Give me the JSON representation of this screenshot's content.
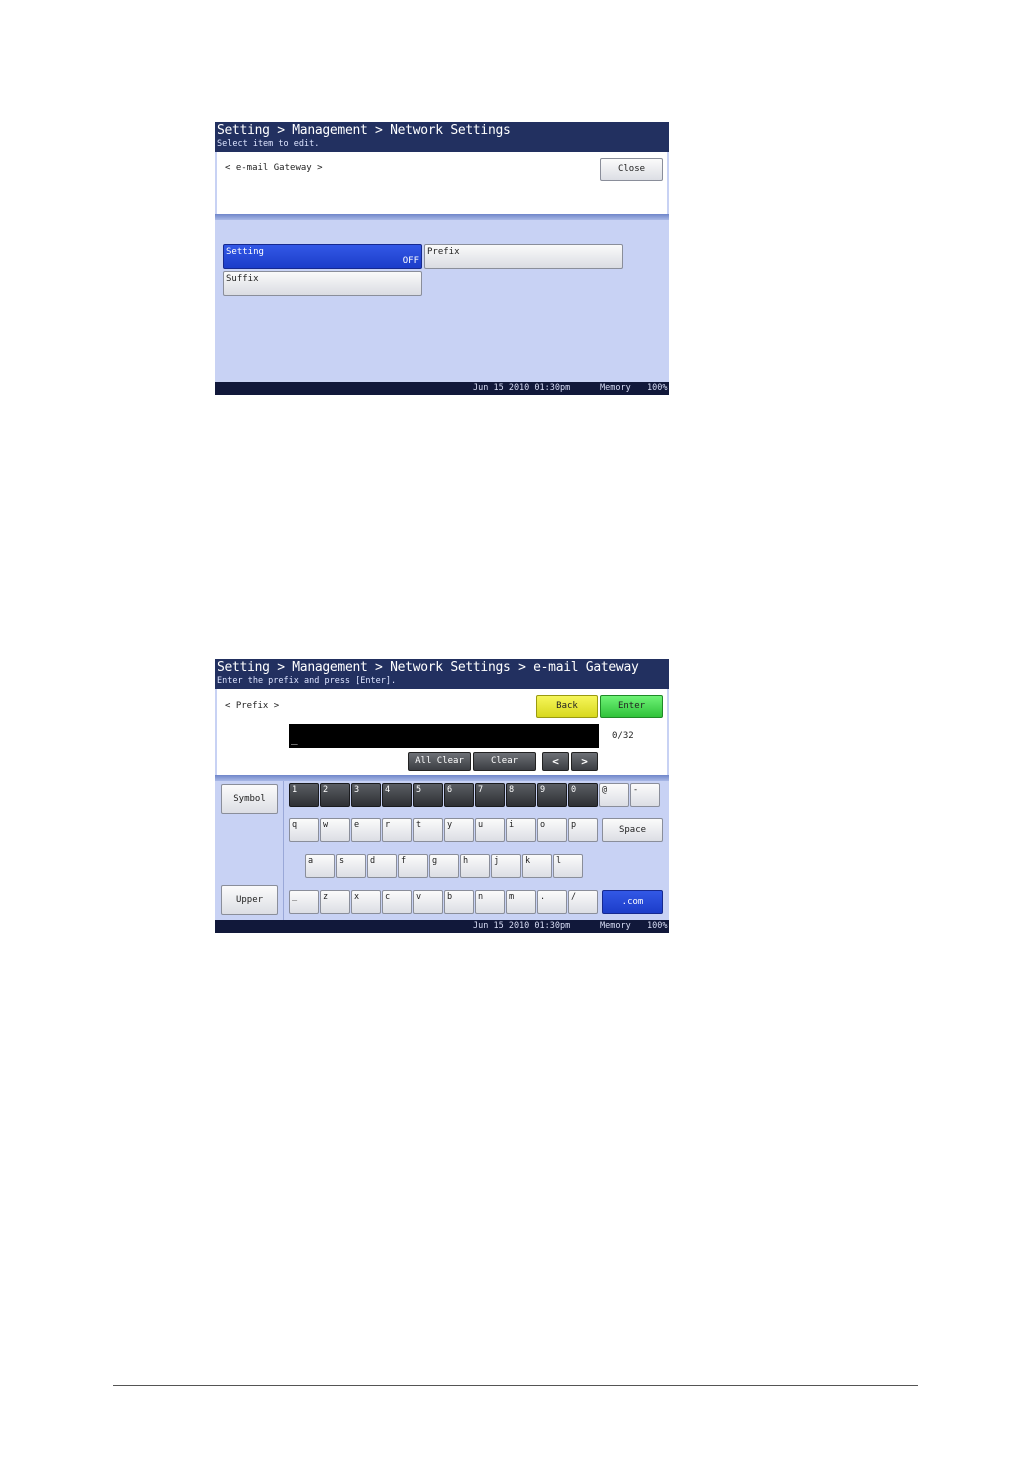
{
  "screen1": {
    "breadcrumb": "Setting > Management > Network Settings",
    "instruction": "Select item to edit.",
    "section_label": "< e-mail Gateway >",
    "close_label": "Close",
    "options": [
      {
        "label": "Setting",
        "value": "OFF",
        "selected": true
      },
      {
        "label": "Prefix",
        "value": "",
        "selected": false
      },
      {
        "label": "Suffix",
        "value": "",
        "selected": false
      }
    ],
    "status": {
      "date": "Jun 15 2010 01:30pm",
      "memory_label": "Memory",
      "memory_value": "100%"
    }
  },
  "screen2": {
    "breadcrumb": "Setting > Management > Network Settings > e-mail Gateway",
    "instruction": "Enter the prefix and press [Enter].",
    "section_label": "< Prefix >",
    "back_label": "Back",
    "enter_label": "Enter",
    "input_value": "_",
    "counter": "0/32",
    "all_clear_label": "All Clear",
    "clear_label": "Clear",
    "arrow_left": "<",
    "arrow_right": ">",
    "symbol_label": "Symbol",
    "upper_label": "Upper",
    "space_label": "Space",
    "dotcom_label": ".com",
    "keys_row1": [
      "1",
      "2",
      "3",
      "4",
      "5",
      "6",
      "7",
      "8",
      "9",
      "0",
      "@",
      "-"
    ],
    "keys_row2": [
      "q",
      "w",
      "e",
      "r",
      "t",
      "y",
      "u",
      "i",
      "o",
      "p"
    ],
    "keys_row3": [
      "a",
      "s",
      "d",
      "f",
      "g",
      "h",
      "j",
      "k",
      "l"
    ],
    "keys_row4": [
      "_",
      "z",
      "x",
      "c",
      "v",
      "b",
      "n",
      "m",
      ".",
      "/"
    ],
    "status": {
      "date": "Jun 15 2010 01:30pm",
      "memory_label": "Memory",
      "memory_value": "100%"
    }
  },
  "colors": {
    "title_bar": "#223060",
    "panel": "#c8d2f4",
    "selected": "#1c3dc9",
    "back_button": "#ecec3a",
    "enter_button": "#3fd64a",
    "dotcom_button": "#1c3dc9"
  }
}
